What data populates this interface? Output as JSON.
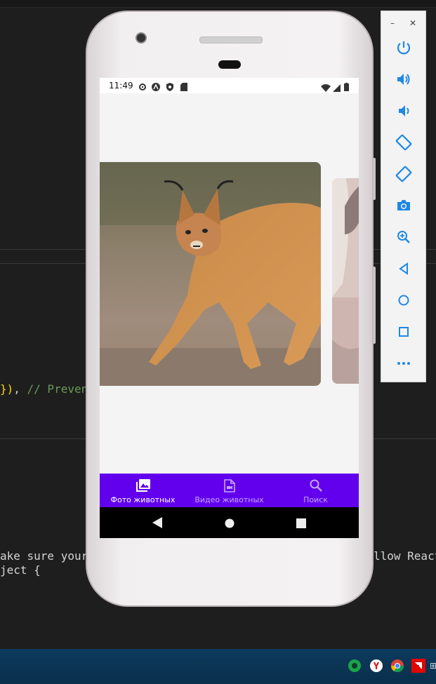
{
  "editor": {
    "code_line_1": {
      "brace": "})",
      "punc": ", ",
      "comment": "// Preven"
    },
    "code_line_2_left": "ake sure your",
    "code_line_2_right": "llow React",
    "code_line_3_left": "ject {"
  },
  "phone": {
    "status_bar": {
      "time": "11:49"
    },
    "bottom_nav": {
      "items": [
        {
          "label": "Фото животных",
          "icon": "photo-library-icon",
          "active": true
        },
        {
          "label": "Видео животных",
          "icon": "video-file-icon",
          "active": false
        },
        {
          "label": "Поиск",
          "icon": "search-icon",
          "active": false
        }
      ],
      "color": "#6200ee"
    },
    "android_nav": {
      "buttons": [
        "back",
        "home",
        "recents"
      ]
    }
  },
  "emulator_toolbar": {
    "window_controls": [
      "minimize",
      "close"
    ],
    "buttons": [
      "power",
      "volume-up",
      "volume-down",
      "rotate-left",
      "rotate-right",
      "screenshot",
      "zoom",
      "back",
      "home",
      "overview",
      "more"
    ],
    "accent_color": "#1e88e5"
  },
  "taskbar": {
    "tray_icons": [
      "network",
      "yandex",
      "chrome",
      "amd",
      "more"
    ]
  }
}
